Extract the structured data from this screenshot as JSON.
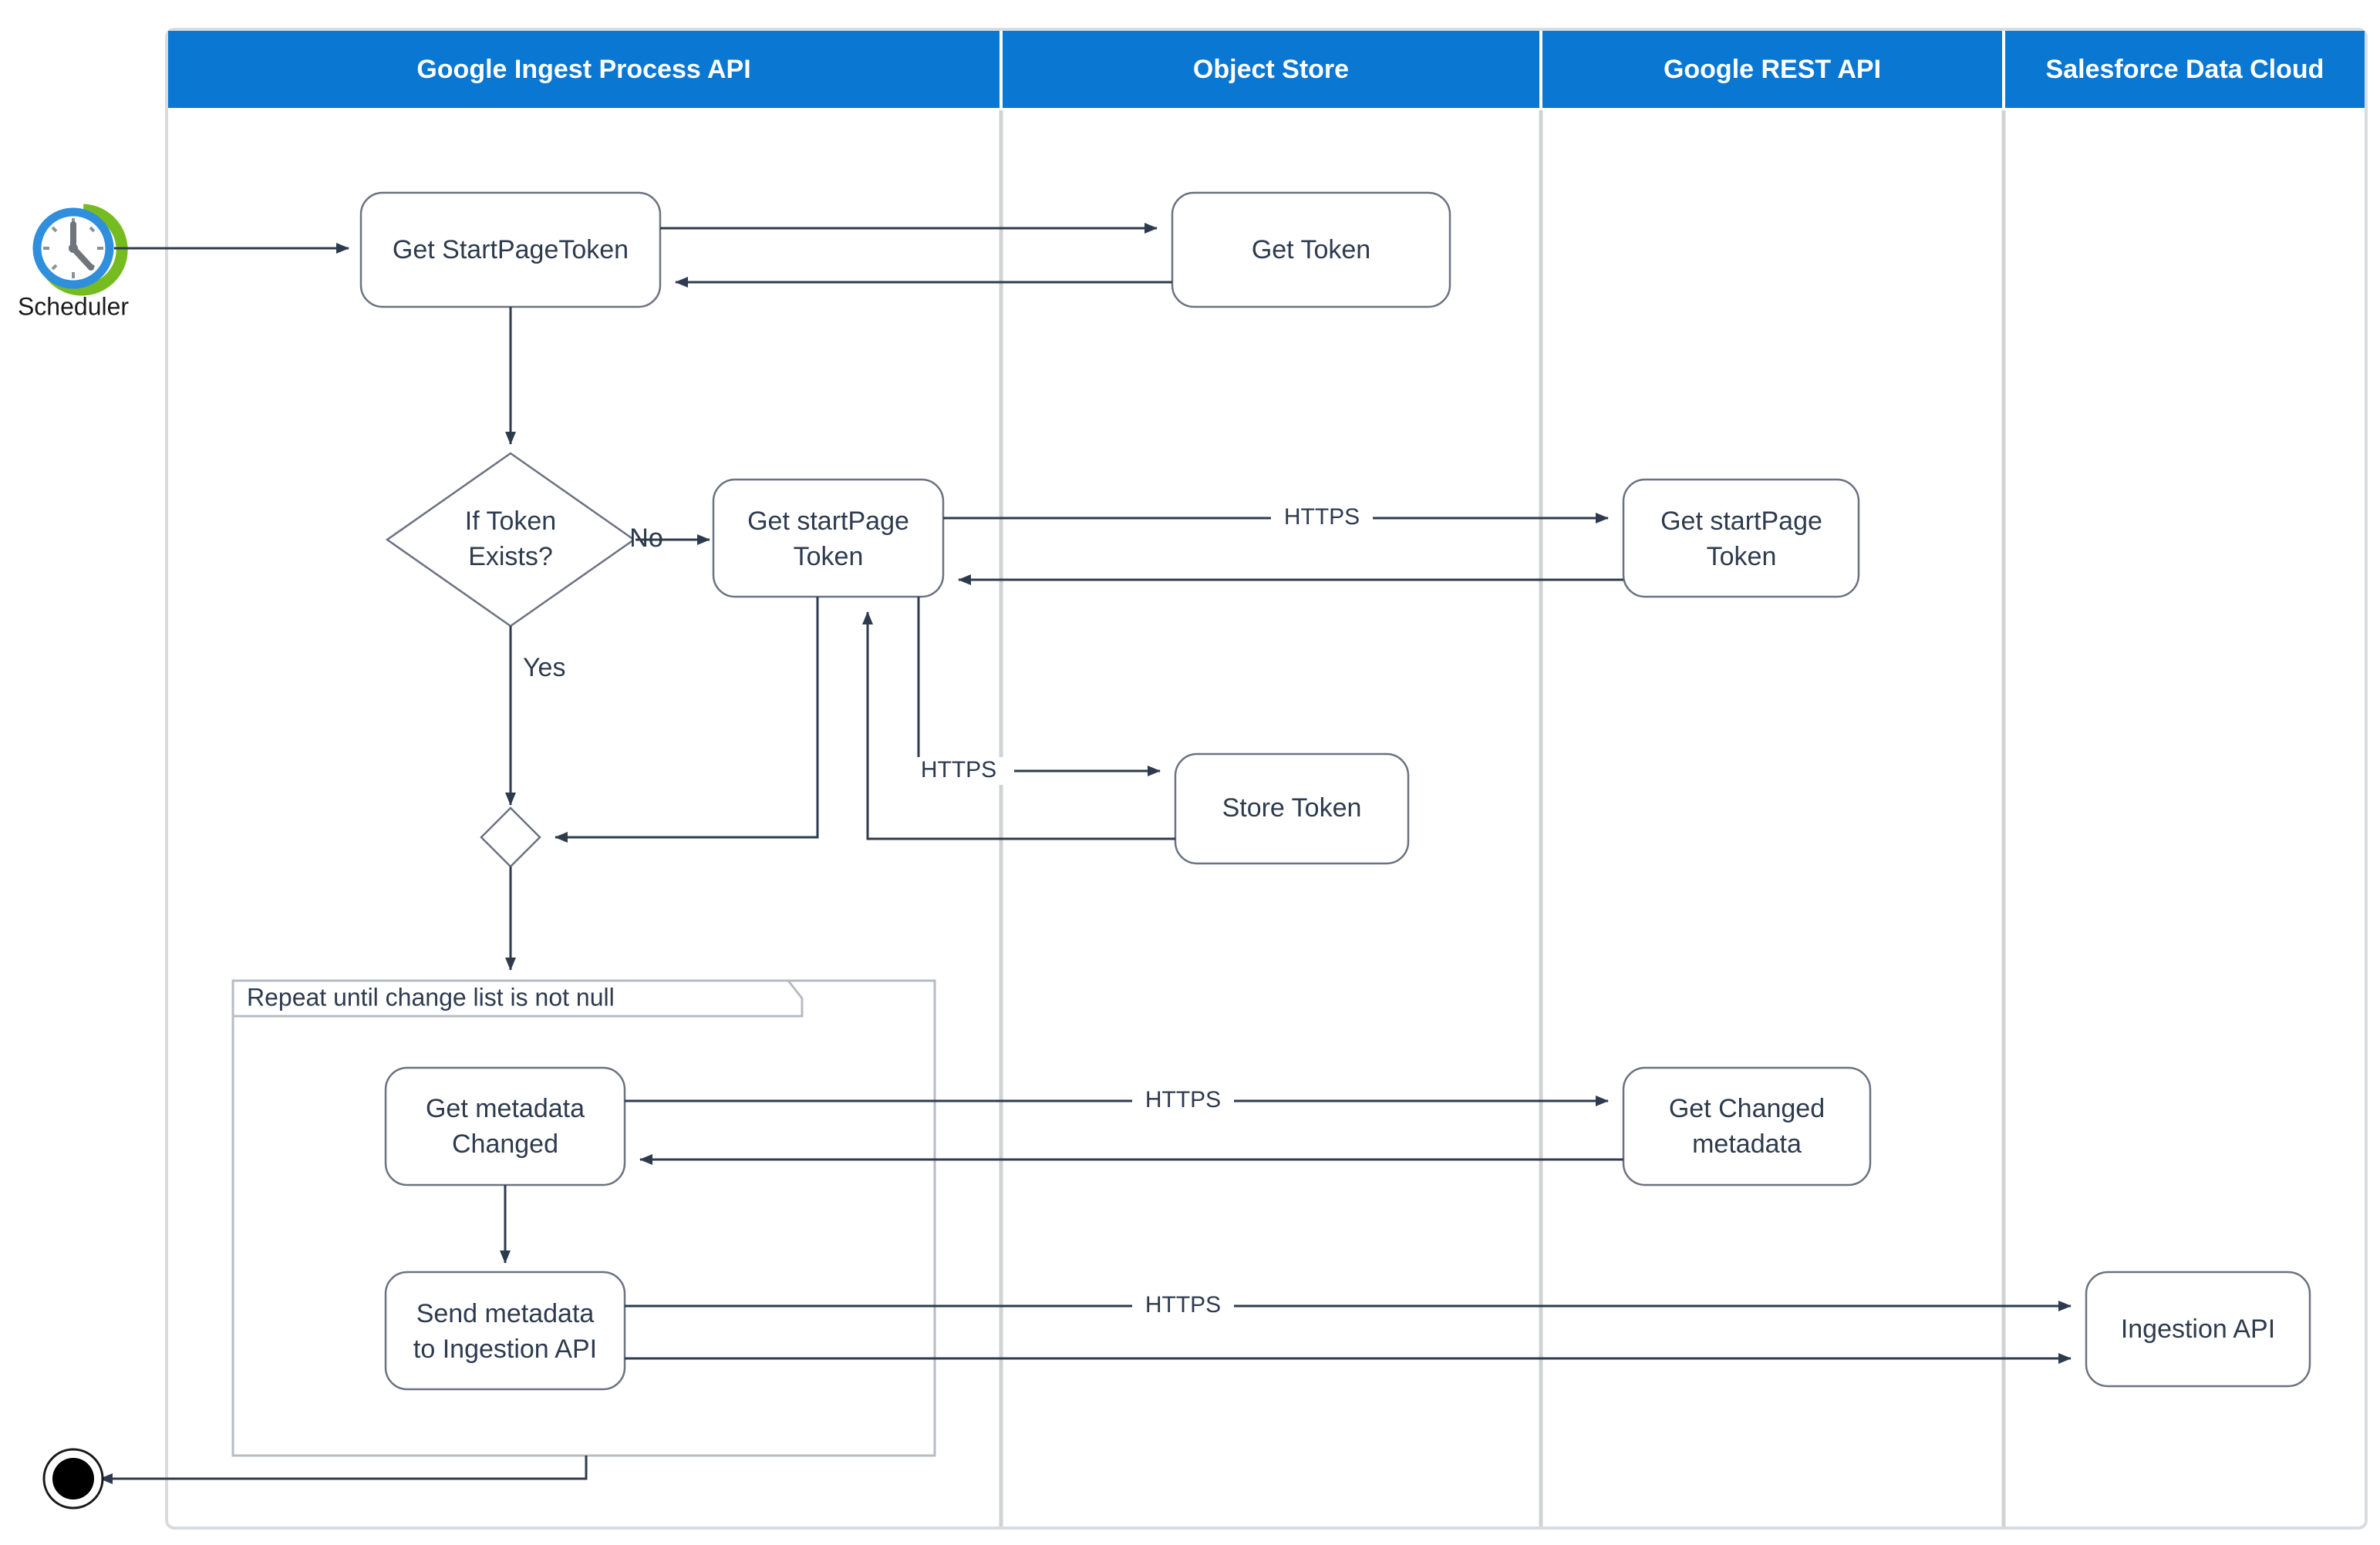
{
  "diagram": {
    "title": "Google Ingest Process API activity diagram",
    "type": "uml-activity-swimlane",
    "accent_color": "#0a77d3",
    "line_color": "#2e3b4e",
    "node_stroke": "#6b7280",
    "lane_divider_color": "#d0d3d6"
  },
  "lanes": [
    {
      "label": "Google Ingest  Process API"
    },
    {
      "label": "Object Store"
    },
    {
      "label": "Google REST API"
    },
    {
      "label": "Salesforce Data Cloud"
    }
  ],
  "actors": {
    "scheduler": {
      "label": "Scheduler",
      "icon": "clock-refresh-icon"
    },
    "end_node": {
      "label": "",
      "icon": "final-node-icon"
    }
  },
  "nodes": [
    {
      "id": "get_startpagetoken",
      "label": "Get StartPageToken",
      "lane": 0,
      "shape": "rounded-rect"
    },
    {
      "id": "get_token",
      "label": "Get Token",
      "lane": 1,
      "shape": "rounded-rect"
    },
    {
      "id": "if_token_exists",
      "label_line1": "If Token",
      "label_line2": "Exists?",
      "lane": 0,
      "shape": "diamond"
    },
    {
      "id": "get_startpage_token_local",
      "label_line1": "Get startPage",
      "label_line2": "Token",
      "lane": 0,
      "shape": "rounded-rect"
    },
    {
      "id": "get_startpage_token_rest",
      "label_line1": "Get startPage",
      "label_line2": "Token",
      "lane": 2,
      "shape": "rounded-rect"
    },
    {
      "id": "store_token",
      "label": "Store Token",
      "lane": 1,
      "shape": "rounded-rect"
    },
    {
      "id": "merge",
      "label": "",
      "lane": 0,
      "shape": "small-diamond"
    },
    {
      "id": "get_metadata_changed",
      "label_line1": "Get  metadata",
      "label_line2": "Changed",
      "lane": 0,
      "shape": "rounded-rect"
    },
    {
      "id": "get_changed_metadata",
      "label_line1": "Get Changed",
      "label_line2": "metadata",
      "lane": 2,
      "shape": "rounded-rect"
    },
    {
      "id": "send_metadata",
      "label_line1": "Send metadata",
      "label_line2": "to Ingestion API",
      "lane": 0,
      "shape": "rounded-rect"
    },
    {
      "id": "ingestion_api",
      "label": "Ingestion API",
      "lane": 3,
      "shape": "rounded-rect"
    }
  ],
  "loop_frame": {
    "label": "Repeat until  change list  is not null"
  },
  "branch_labels": {
    "no": "No",
    "yes": "Yes"
  },
  "edge_labels": {
    "https_1": "HTTPS",
    "https_2": "HTTPS",
    "https_3": "HTTPS",
    "https_4": "HTTPS"
  },
  "chart_data": {
    "type": "diagram",
    "title": "Google Ingest Process API",
    "swimlanes": [
      "Google Ingest  Process API",
      "Object Store",
      "Google REST API",
      "Salesforce Data Cloud"
    ],
    "steps": [
      "Scheduler triggers Get StartPageToken",
      "Get StartPageToken calls Get Token in Object Store and receives response",
      "Decision: If Token Exists?",
      "No -> Get startPage Token (local) -> HTTPS -> Get startPage Token (Google REST API) -> response",
      "Get startPage Token -> HTTPS -> Store Token (Object Store) -> response -> merge",
      "Yes -> merge node",
      "Loop: Repeat until change list is not null",
      "Get metadata Changed -> HTTPS -> Get Changed metadata (Google REST API) -> response",
      "Send metadata to Ingestion API -> HTTPS -> Ingestion API (Salesforce Data Cloud) -> response",
      "Loop exit -> final node"
    ]
  }
}
